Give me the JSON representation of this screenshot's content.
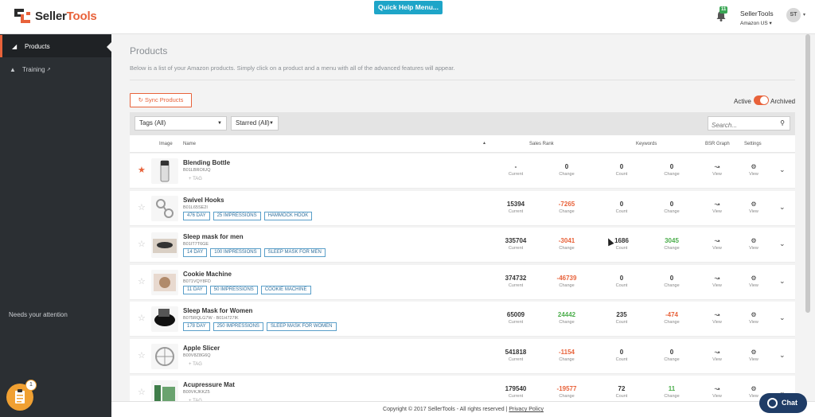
{
  "header": {
    "logo_seller": "Seller",
    "logo_tools": "Tools",
    "quick_help": "Quick Help Menu...",
    "bell_badge": "11",
    "account_name": "SellerTools",
    "account_region": "Amazon US",
    "avatar_initials": "ST",
    "colors": {
      "brand": "#e8623a",
      "help": "#1ea5c8"
    }
  },
  "sidebar": {
    "items": [
      {
        "label": "Products",
        "icon": "tag-icon"
      },
      {
        "label": "Training",
        "icon": "graduation-cap-icon"
      }
    ],
    "needs_attention": "Needs your attention",
    "clipboard_badge": "1"
  },
  "main": {
    "title": "Products",
    "intro": "Below is a list of your Amazon products. Simply click on a product and a menu with all of the advanced features will appear.",
    "sync_label": "Sync Products",
    "active_label": "Active",
    "archived_label": "Archived",
    "filters": {
      "tags": "Tags (All)",
      "starred": "Starred (All)",
      "search_placeholder": "Search..."
    },
    "columns": {
      "image": "Image",
      "name": "Name",
      "sales_rank": "Sales Rank",
      "keywords": "Keywords",
      "bsr_graph": "BSR Graph",
      "settings": "Settings"
    },
    "sub_labels": {
      "current": "Current",
      "change": "Change",
      "count": "Count",
      "view": "View",
      "add_tag": "+ TAG"
    },
    "rows": [
      {
        "name": "Blending Bottle",
        "asin": "B01LBROIUQ",
        "starred": true,
        "tags": [],
        "rank": "-",
        "rank_change": "0",
        "kw_count": "0",
        "kw_change": "0"
      },
      {
        "name": "Swivel Hooks",
        "asin": "B01L65SE2I",
        "starred": false,
        "tags": [
          "476 DAY",
          "25 IMPRESSIONS",
          "HAMMOCK HOOK"
        ],
        "rank": "15394",
        "rank_change": "-7265",
        "kw_count": "0",
        "kw_change": "0"
      },
      {
        "name": "Sleep mask for men",
        "asin": "B01IT7T6GE",
        "starred": false,
        "tags": [
          "14 DAY",
          "100 IMPRESSIONS",
          "SLEEP MASK FOR MEN"
        ],
        "rank": "335704",
        "rank_change": "-3041",
        "kw_count": "1686",
        "kw_change": "3045"
      },
      {
        "name": "Cookie Machine",
        "asin": "B071VQY8FD",
        "starred": false,
        "tags": [
          "11 DAY",
          "50 IMPRESSIONS",
          "COOKIE MACHINE"
        ],
        "rank": "374732",
        "rank_change": "-46739",
        "kw_count": "0",
        "kw_change": "0"
      },
      {
        "name": "Sleep Mask for Women",
        "asin": "B075RQLG7W - B01H727IK",
        "starred": false,
        "tags": [
          "178 DAY",
          "250 IMPRESSIONS",
          "SLEEP MASK FOR WOMEN"
        ],
        "rank": "65009",
        "rank_change": "24442",
        "kw_count": "235",
        "kw_change": "-474"
      },
      {
        "name": "Apple Slicer",
        "asin": "B00V8Z8G6Q",
        "starred": false,
        "tags": [],
        "rank": "541818",
        "rank_change": "-1154",
        "kw_count": "0",
        "kw_change": "0"
      },
      {
        "name": "Acupressure Mat",
        "asin": "B00VKJKKZ5",
        "starred": false,
        "tags": [],
        "rank": "179540",
        "rank_change": "-19577",
        "kw_count": "72",
        "kw_change": "11"
      }
    ]
  },
  "footer": {
    "copyright": "Copyright © 2017 SellerTools - All rights reserved |",
    "privacy": "Privacy Policy"
  },
  "chat": {
    "label": "Chat"
  }
}
